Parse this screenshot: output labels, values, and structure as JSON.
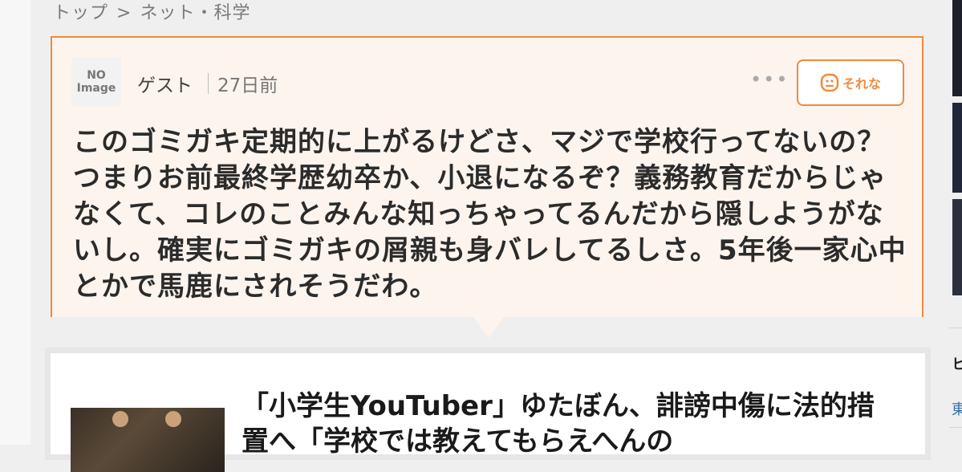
{
  "breadcrumb": {
    "home": "トップ",
    "separator": ">",
    "current": "ネット・科学"
  },
  "comment": {
    "avatar_line1": "NO",
    "avatar_line2": "Image",
    "user": "ゲスト",
    "time": "27日前",
    "more": "•••",
    "reaction_label": "それな",
    "text": "このゴミガキ定期的に上がるけどさ、マジで学校行ってないの？つまりお前最終学歴幼卒か、小退になるぞ？義務教育だからじゃなくて、コレのことみんな知っちゃってるんだから隠しようがないし。確実にゴミガキの屑親も身バレしてるしさ。5年後一家心中とかで馬鹿にされそうだわ。"
  },
  "article": {
    "title": "「小学生YouTuber」ゆたぼん、誹謗中傷に法的措置へ「学校では教えてもらえへんの"
  },
  "right_rail": {
    "heading_char": "ヒ",
    "link_char": "東"
  },
  "colors": {
    "accent": "#f08a3c",
    "card_bg": "#fdf4ee"
  },
  "icons": {
    "reaction": "neutral-face-icon",
    "more": "more-dots-icon"
  }
}
